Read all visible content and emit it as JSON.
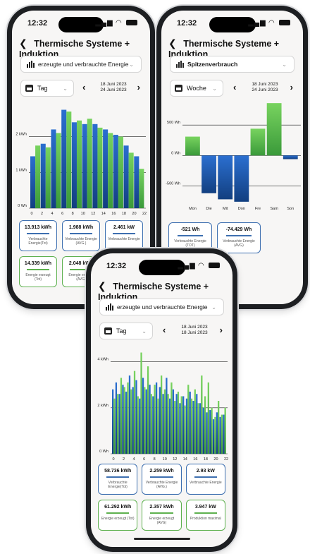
{
  "status_time": "12:32",
  "nav_title": "Thermische Systeme + Induktion",
  "colors": {
    "blue": "#1f5fb4",
    "green": "#5bb94c",
    "card_blue": "#3d6fb0",
    "card_green": "#5eb14f"
  },
  "phone_left": {
    "metric_select": "erzeugte und verbrauchte Energie",
    "period": "Tag",
    "date_line1": "18 Juni 2023",
    "date_line2": "24 Juni 2023",
    "chart_data": {
      "type": "bar",
      "y_ticks": [
        "2 kWh",
        "1 kWh",
        "0 Wh"
      ],
      "x_ticks": [
        "0",
        "2",
        "4",
        "6",
        "8",
        "10",
        "12",
        "14",
        "16",
        "18",
        "20",
        "22"
      ],
      "ylim": [
        0,
        2.8
      ],
      "series": [
        {
          "color": "blue",
          "values": [
            1.45,
            1.8,
            2.2,
            2.75,
            2.4,
            2.35,
            2.35,
            2.2,
            2.05,
            1.75,
            1.45
          ]
        },
        {
          "color": "green",
          "values": [
            1.75,
            1.7,
            2.1,
            2.7,
            2.45,
            2.5,
            2.25,
            2.1,
            2.0,
            1.55,
            1.1
          ]
        }
      ]
    },
    "cards": [
      {
        "value": "13.913 kWh",
        "label": "Verbrauchte Energie(Tot)",
        "color": "blue"
      },
      {
        "value": "1.988 kWh",
        "label": "Verbrauchte Energie (AVG.)",
        "color": "blue"
      },
      {
        "value": "2.461 kW",
        "label": "Verbrauchte Energie",
        "color": "blue"
      },
      {
        "value": "14.339 kWh",
        "label": "Energie erzeugt (Tot)",
        "color": "green"
      },
      {
        "value": "2.048 kWh",
        "label": "Energie erzeugt (AVG)",
        "color": "green"
      },
      {
        "value": "",
        "label": "",
        "color": "green"
      }
    ]
  },
  "phone_right": {
    "metric_select": "Spitzenverbrauch",
    "period": "Woche",
    "date_line1": "18 Juni 2023",
    "date_line2": "24 Juni 2023",
    "chart_data": {
      "type": "bar",
      "y_ticks": [
        "500 Wh",
        "0 Wh",
        "-500 Wh"
      ],
      "x_ticks": [
        "Mon",
        "Die",
        "Mit",
        "Don",
        "Fre",
        "Sam",
        "Son"
      ],
      "ylim": [
        -750,
        850
      ],
      "values": [
        310,
        -620,
        -720,
        -760,
        440,
        860,
        -60
      ],
      "bar_colors": [
        "green",
        "blue",
        "blue",
        "blue",
        "green",
        "green",
        "blue"
      ]
    },
    "cards": [
      {
        "value": "-521 Wh",
        "label": "Verbrauchte Energie (TOT)",
        "color": "blue"
      },
      {
        "value": "-74.429 Wh",
        "label": "Verbrauchte Energie (AVG)",
        "color": "blue"
      }
    ]
  },
  "phone_center": {
    "metric_select": "erzeugte und verbrauchte Energie",
    "period": "Tag",
    "date_line1": "18 Juni 2023",
    "date_line2": "18 Juni 2023",
    "chart_data": {
      "type": "bar",
      "y_ticks": [
        "4 kWh",
        "2 kWh",
        "0 Wh"
      ],
      "x_ticks": [
        "0",
        "2",
        "4",
        "6",
        "8",
        "10",
        "12",
        "14",
        "16",
        "18",
        "20",
        "22"
      ],
      "ylim": [
        0,
        4.6
      ],
      "series": [
        {
          "color": "blue",
          "values": [
            2.8,
            3.1,
            2.6,
            3.0,
            2.7,
            3.4,
            2.9,
            3.2,
            2.4,
            3.3,
            2.8,
            3.0,
            2.5,
            3.1,
            2.9,
            2.6,
            3.3,
            2.4,
            2.8,
            2.6,
            2.2,
            2.5,
            2.4,
            2.7,
            2.3,
            2.6,
            2.2,
            2.0,
            1.8,
            1.9,
            1.5,
            1.8,
            1.6,
            1.7
          ]
        },
        {
          "color": "green",
          "values": [
            2.4,
            2.6,
            3.3,
            2.9,
            3.1,
            2.8,
            3.6,
            2.5,
            4.4,
            2.9,
            3.8,
            2.6,
            3.0,
            2.4,
            3.4,
            2.8,
            2.6,
            3.1,
            2.3,
            2.7,
            2.5,
            2.1,
            3.0,
            2.4,
            2.8,
            2.2,
            3.4,
            2.5,
            3.1,
            2.0,
            1.6,
            2.3,
            1.7,
            2.0
          ]
        }
      ]
    },
    "cards": [
      {
        "value": "58.736 kWh",
        "label": "Verbrauchte Energie(Tot)",
        "color": "blue"
      },
      {
        "value": "2.259 kWh",
        "label": "Verbrauchte Energie (AVG.)",
        "color": "blue"
      },
      {
        "value": "2.93 kW",
        "label": "Verbrauchte Energie",
        "color": "blue"
      },
      {
        "value": "61.292 kWh",
        "label": "Energie erzeugt (Tot)",
        "color": "green"
      },
      {
        "value": "2.357 kWh",
        "label": "Energie erzeugt (AVG)",
        "color": "green"
      },
      {
        "value": "3.947 kW",
        "label": "Produktion maximal",
        "color": "green"
      }
    ]
  }
}
